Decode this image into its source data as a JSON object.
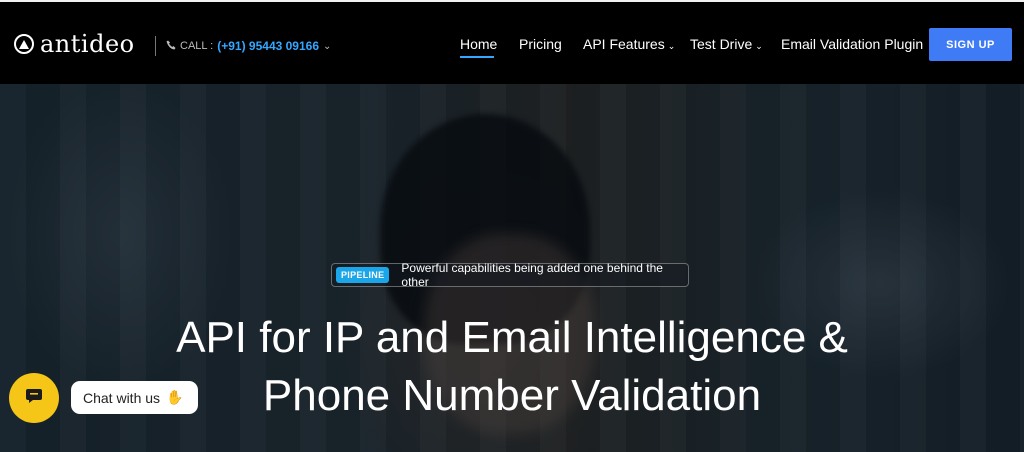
{
  "brand": {
    "name": "antideo",
    "logo_icon": "antideo-logo-icon"
  },
  "contact": {
    "label": "CALL :",
    "phone": "(+91) 95443 09166",
    "icon": "phone-icon"
  },
  "nav": {
    "items": [
      {
        "label": "Home",
        "active": true
      },
      {
        "label": "Pricing"
      },
      {
        "label": "API Features",
        "dropdown": true
      },
      {
        "label": "Test Drive",
        "dropdown": true
      },
      {
        "label": "Email Validation Plugin"
      }
    ],
    "signup_label": "SIGN UP",
    "accent_color": "#3e7bf5",
    "active_underline_color": "#35a7ff"
  },
  "hero": {
    "badge_tag": "PIPELINE",
    "badge_text": "Powerful capabilities being added one behind the other",
    "headline_line1": "API for IP and Email Intelligence &",
    "headline_line2": "Phone Number Validation"
  },
  "chat": {
    "label": "Chat with us",
    "emoji_icon": "waving-hand-icon",
    "bubble_color": "#f5c518"
  }
}
